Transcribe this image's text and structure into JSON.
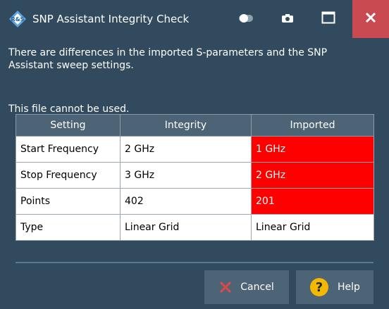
{
  "window": {
    "title": "SNP Assistant Integrity Check"
  },
  "message": {
    "line1": "There are differences in the imported S-parameters and the SNP",
    "line2": "Assistant sweep settings.",
    "line3": "This file cannot be used."
  },
  "table": {
    "headers": [
      "Setting",
      "Integrity",
      "Imported"
    ],
    "rows": [
      {
        "setting": "Start Frequency",
        "integrity": "2 GHz",
        "imported": "1 GHz",
        "mismatch": true
      },
      {
        "setting": "Stop Frequency",
        "integrity": "3 GHz",
        "imported": "2 GHz",
        "mismatch": true
      },
      {
        "setting": "Points",
        "integrity": "402",
        "imported": "201",
        "mismatch": true
      },
      {
        "setting": "Type",
        "integrity": "Linear Grid",
        "imported": "Linear Grid",
        "mismatch": false
      }
    ]
  },
  "buttons": {
    "cancel_label": "Cancel",
    "help_label": "Help"
  },
  "colors": {
    "window_bg": "#324a5e",
    "header_bg": "#4d6376",
    "mismatch": "#ff0000",
    "close": "#c94a50",
    "help_icon": "#f5b800",
    "cancel_icon": "#e04848"
  },
  "icons": {
    "logo": "rs-logo-icon",
    "toggle": "toggle-icon",
    "camera": "camera-icon",
    "maximize": "maximize-icon",
    "close": "close-icon",
    "cancel": "x-icon",
    "help": "question-icon"
  }
}
